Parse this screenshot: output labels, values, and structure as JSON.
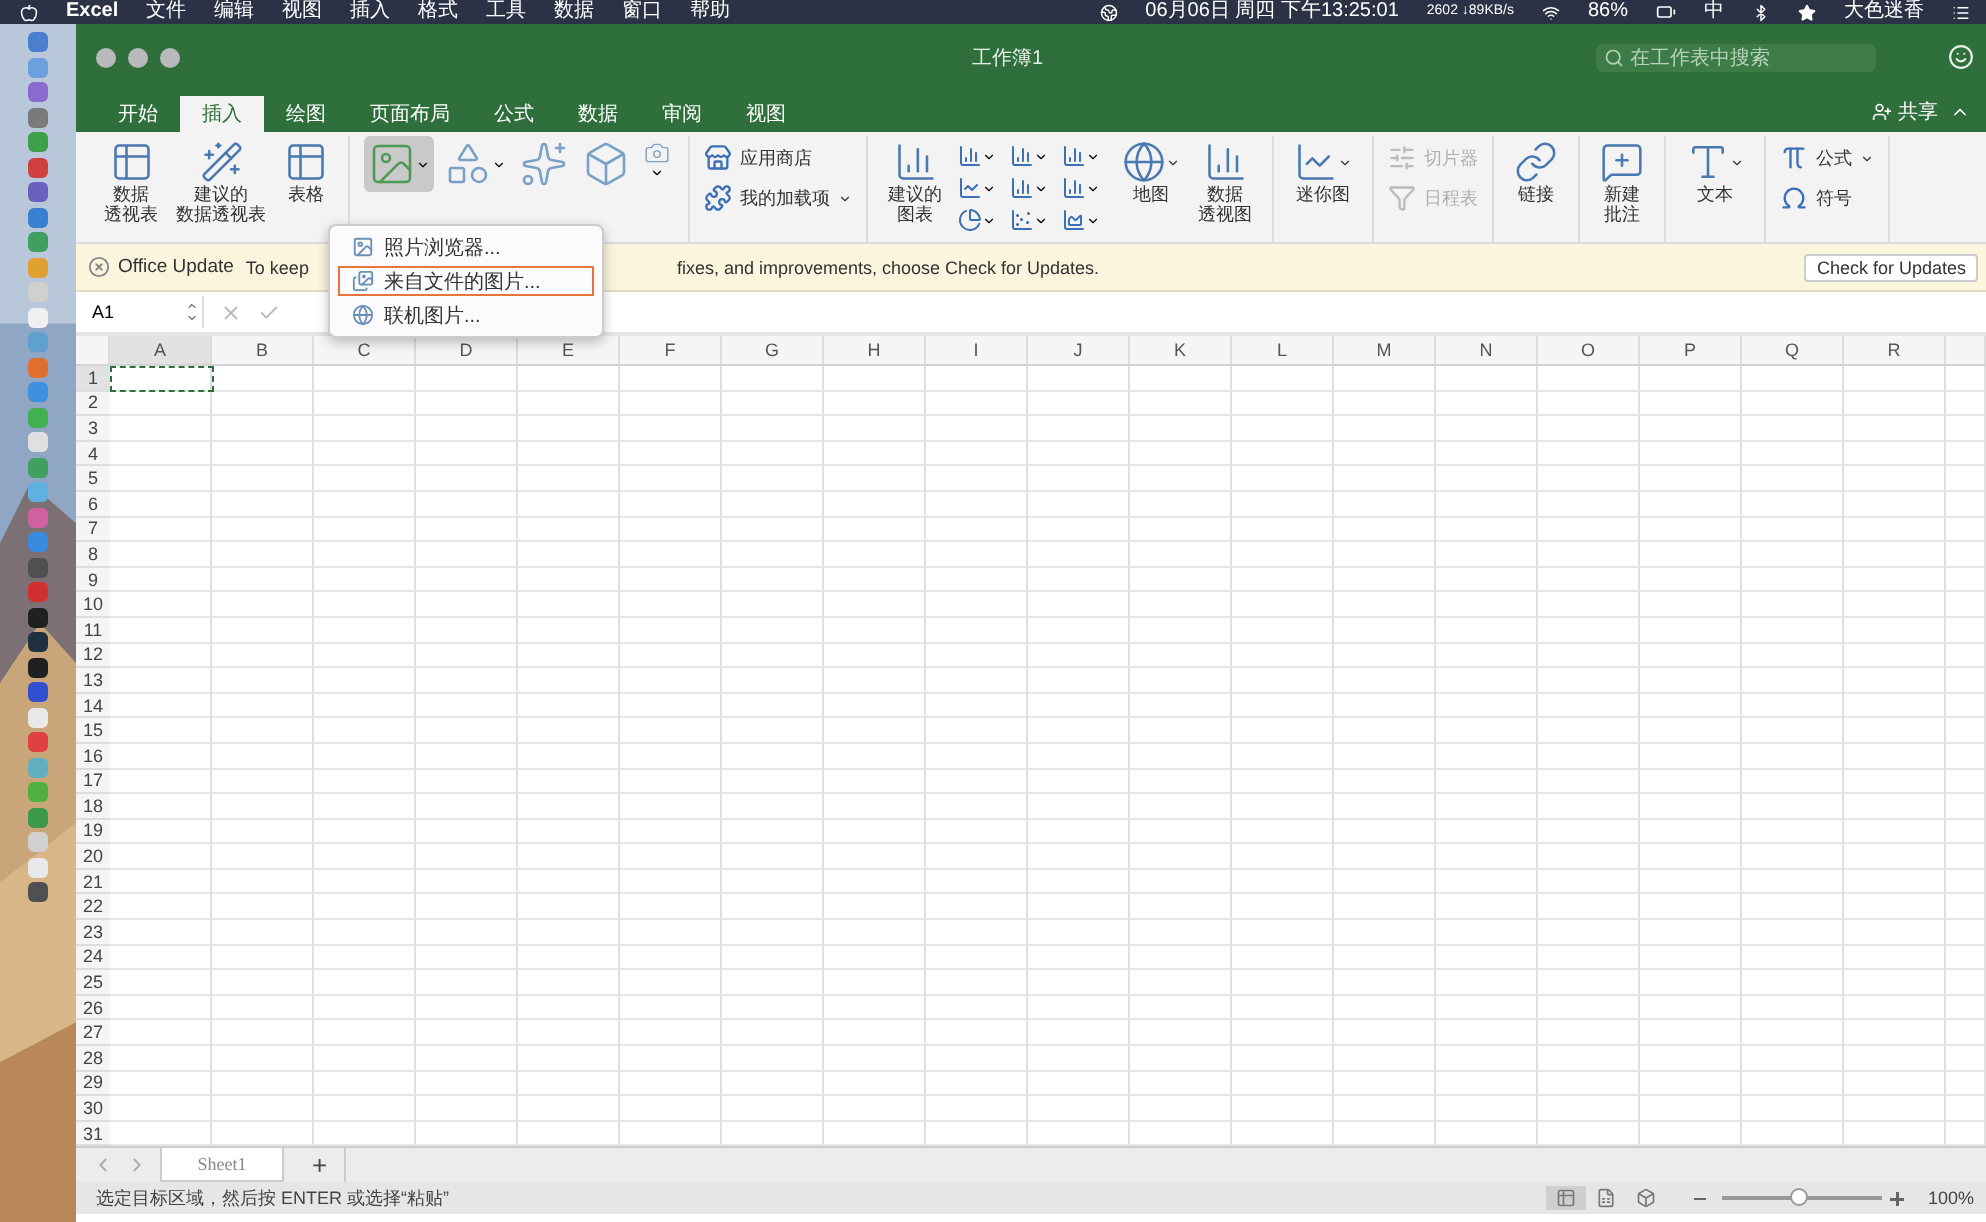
{
  "menubar": {
    "app": "Excel",
    "menus": [
      "文件",
      "编辑",
      "视图",
      "插入",
      "格式",
      "工具",
      "数据",
      "窗口",
      "帮助"
    ],
    "clock": "06月06日 周四 下午13:25:01",
    "network": "2602 ↓89KB/s",
    "battery": "86%",
    "input": "中",
    "user": "大色迷香"
  },
  "window": {
    "title": "工作簿1",
    "search_placeholder": "在工作表中搜索",
    "share": "共享"
  },
  "tabs": [
    {
      "label": "开始",
      "selected": false
    },
    {
      "label": "插入",
      "selected": true
    },
    {
      "label": "绘图",
      "selected": false
    },
    {
      "label": "页面布局",
      "selected": false
    },
    {
      "label": "公式",
      "selected": false
    },
    {
      "label": "数据",
      "selected": false
    },
    {
      "label": "审阅",
      "selected": false
    },
    {
      "label": "视图",
      "selected": false
    }
  ],
  "ribbon": [
    [
      {
        "kind": "large",
        "lines": [
          "数据",
          "透视表"
        ],
        "selected": false
      },
      {
        "kind": "large",
        "lines": [
          "建议的",
          "数据透视表"
        ],
        "selected": false
      },
      {
        "kind": "large",
        "lines": [
          "表格"
        ],
        "selected": false
      }
    ],
    [
      {
        "kind": "tool",
        "caret": true,
        "selected": true
      },
      {
        "kind": "tool",
        "caret": true,
        "selected": false
      },
      {
        "kind": "tool",
        "caret": false,
        "selected": false
      },
      {
        "kind": "tool",
        "caret": false,
        "selected": false
      },
      {
        "kind": "tools",
        "caret": true,
        "selected": false
      }
    ],
    [
      {
        "kind": "stack",
        "items": [
          {
            "label": "应用商店",
            "caret": false,
            "disabled": false
          },
          {
            "label": "我的加载项",
            "caret": true,
            "disabled": false
          }
        ]
      }
    ],
    [
      {
        "kind": "large",
        "lines": [
          "建议的",
          "图表"
        ],
        "selected": false
      },
      {
        "kind": "chart-grid",
        "selected": false
      },
      {
        "kind": "large",
        "lines": [
          "地图"
        ],
        "caret": true,
        "selected": false
      },
      {
        "kind": "large",
        "lines": [
          "数据",
          "透视图"
        ],
        "selected": false
      }
    ],
    [
      {
        "kind": "large",
        "lines": [
          "迷你图"
        ],
        "caret": true,
        "selected": false
      }
    ],
    [
      {
        "kind": "stack",
        "items": [
          {
            "label": "切片器",
            "caret": false,
            "disabled": true
          },
          {
            "label": "日程表",
            "caret": false,
            "disabled": true
          }
        ]
      }
    ],
    [
      {
        "kind": "large",
        "lines": [
          "链接"
        ],
        "selected": false
      }
    ],
    [
      {
        "kind": "large",
        "lines": [
          "新建",
          "批注"
        ],
        "selected": false
      }
    ],
    [
      {
        "kind": "large",
        "lines": [
          "文本"
        ],
        "caret": true,
        "selected": false
      }
    ],
    [
      {
        "kind": "stack",
        "items": [
          {
            "label": "公式",
            "caret": true,
            "disabled": false
          },
          {
            "label": "符号",
            "caret": false,
            "disabled": false
          }
        ]
      }
    ]
  ],
  "picture_menu": [
    {
      "label": "照片浏览器...",
      "selected": false
    },
    {
      "label": "来自文件的图片...",
      "selected": true
    },
    {
      "label": "联机图片...",
      "selected": false
    }
  ],
  "update_bar": {
    "title": "Office Update",
    "message_start": "To keep",
    "message_end": "fixes, and improvements, choose Check for Updates.",
    "button": "Check for Updates"
  },
  "formula_bar": {
    "cell": "A1"
  },
  "columns": [
    {
      "label": "A",
      "selected": true
    },
    {
      "label": "B",
      "selected": false
    },
    {
      "label": "C",
      "selected": false
    },
    {
      "label": "D",
      "selected": false
    },
    {
      "label": "E",
      "selected": false
    },
    {
      "label": "F",
      "selected": false
    },
    {
      "label": "G",
      "selected": false
    },
    {
      "label": "H",
      "selected": false
    },
    {
      "label": "I",
      "selected": false
    },
    {
      "label": "J",
      "selected": false
    },
    {
      "label": "K",
      "selected": false
    },
    {
      "label": "L",
      "selected": false
    },
    {
      "label": "M",
      "selected": false
    },
    {
      "label": "N",
      "selected": false
    },
    {
      "label": "O",
      "selected": false
    },
    {
      "label": "P",
      "selected": false
    },
    {
      "label": "Q",
      "selected": false
    },
    {
      "label": "R",
      "selected": false
    }
  ],
  "rows": [
    {
      "label": "1",
      "selected": true
    },
    {
      "label": "2",
      "selected": false
    },
    {
      "label": "3",
      "selected": false
    },
    {
      "label": "4",
      "selected": false
    },
    {
      "label": "5",
      "selected": false
    },
    {
      "label": "6",
      "selected": false
    },
    {
      "label": "7",
      "selected": false
    },
    {
      "label": "8",
      "selected": false
    },
    {
      "label": "9",
      "selected": false
    },
    {
      "label": "10",
      "selected": false
    },
    {
      "label": "11",
      "selected": false
    },
    {
      "label": "12",
      "selected": false
    },
    {
      "label": "13",
      "selected": false
    },
    {
      "label": "14",
      "selected": false
    },
    {
      "label": "15",
      "selected": false
    },
    {
      "label": "16",
      "selected": false
    },
    {
      "label": "17",
      "selected": false
    },
    {
      "label": "18",
      "selected": false
    },
    {
      "label": "19",
      "selected": false
    },
    {
      "label": "20",
      "selected": false
    },
    {
      "label": "21",
      "selected": false
    },
    {
      "label": "22",
      "selected": false
    },
    {
      "label": "23",
      "selected": false
    },
    {
      "label": "24",
      "selected": false
    },
    {
      "label": "25",
      "selected": false
    },
    {
      "label": "26",
      "selected": false
    },
    {
      "label": "27",
      "selected": false
    },
    {
      "label": "28",
      "selected": false
    },
    {
      "label": "29",
      "selected": false
    },
    {
      "label": "30",
      "selected": false
    },
    {
      "label": "31",
      "selected": false
    }
  ],
  "sheet_tabs": [
    {
      "label": "Sheet1",
      "selected": true
    }
  ],
  "add_sheet": "+",
  "status_bar": {
    "message": "选定目标区域，然后按 ENTER 或选择“粘贴”",
    "views": [
      {
        "kind": "normal",
        "selected": true
      },
      {
        "kind": "layout",
        "selected": false
      },
      {
        "kind": "break",
        "selected": false
      }
    ],
    "zoom": {
      "level": 0.48,
      "reading": "100%"
    }
  }
}
